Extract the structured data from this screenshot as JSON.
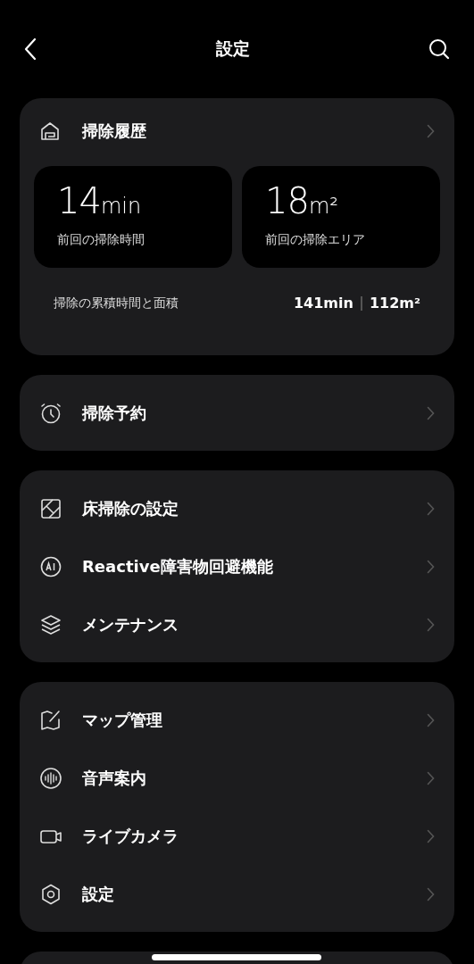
{
  "header": {
    "title": "設定"
  },
  "history": {
    "title": "掃除履歴",
    "stats": [
      {
        "value": "14",
        "unit": "min",
        "label": "前回の掃除時間"
      },
      {
        "value": "18",
        "unit": "m²",
        "label": "前回の掃除エリア"
      }
    ],
    "total_label": "掃除の累積時間と面積",
    "total_time": "141min",
    "total_area": "112m²"
  },
  "groups": [
    {
      "items": [
        {
          "label": "掃除予約"
        }
      ]
    },
    {
      "items": [
        {
          "label": "床掃除の設定"
        },
        {
          "label": "Reactive障害物回避機能"
        },
        {
          "label": "メンテナンス"
        }
      ]
    },
    {
      "items": [
        {
          "label": "マップ管理"
        },
        {
          "label": "音声案内"
        },
        {
          "label": "ライブカメラ"
        },
        {
          "label": "設定"
        }
      ]
    }
  ]
}
